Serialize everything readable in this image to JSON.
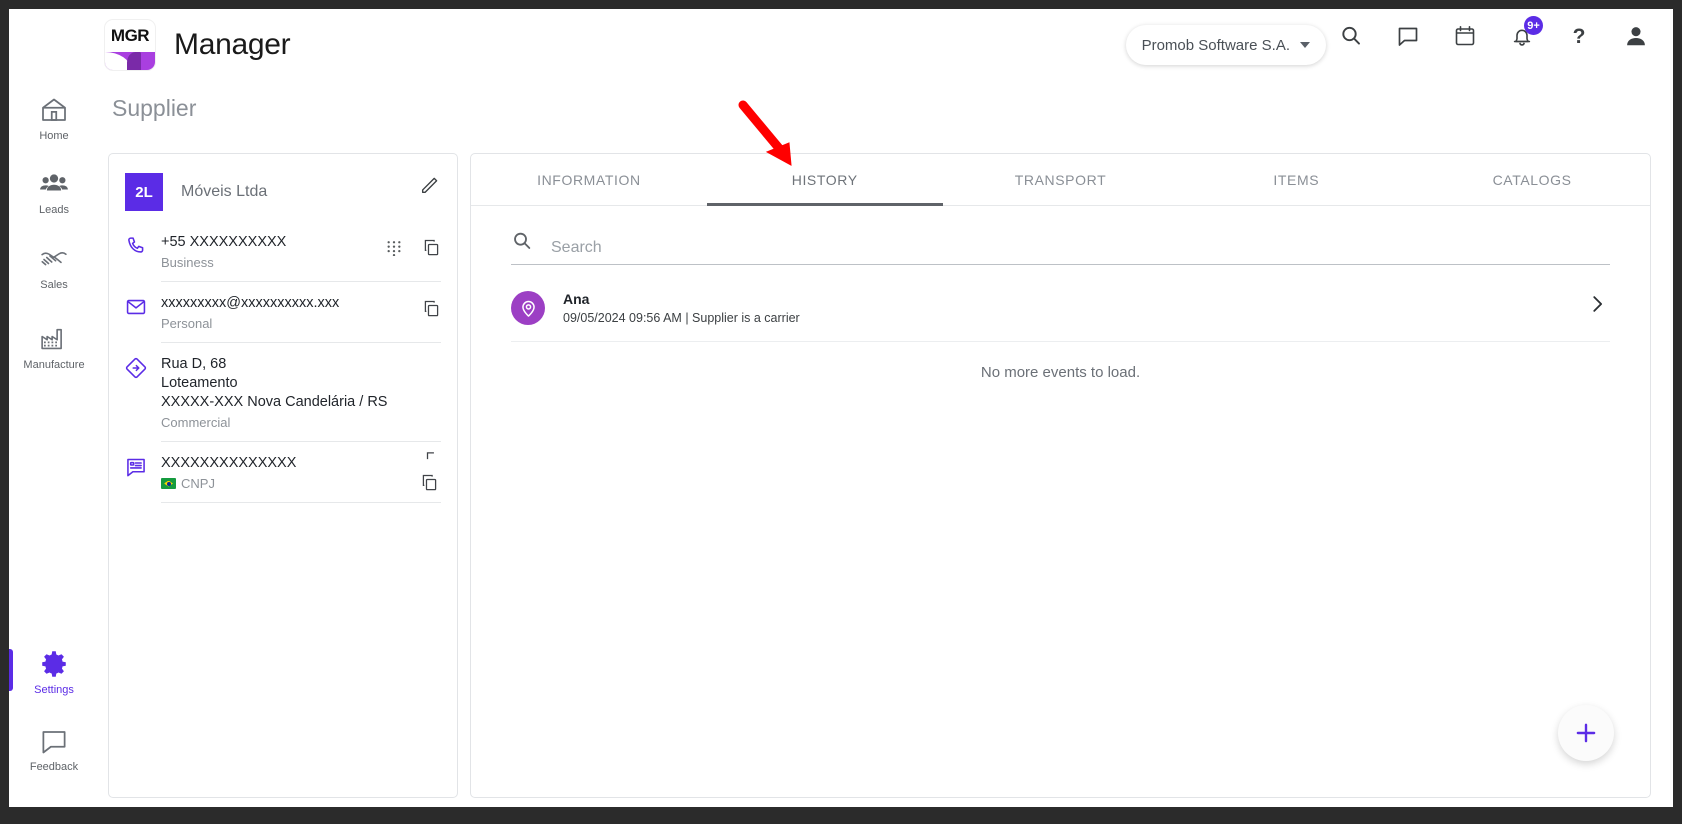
{
  "app": {
    "logo_text": "MGR",
    "title": "Manager"
  },
  "header": {
    "org_name": "Promob Software S.A.",
    "icons": [
      {
        "name": "search-icon"
      },
      {
        "name": "chat-icon"
      },
      {
        "name": "calendar-icon"
      },
      {
        "name": "notifications-bell-icon",
        "badge": "9+"
      },
      {
        "name": "help-question-icon"
      },
      {
        "name": "user-account-icon"
      }
    ]
  },
  "sidebar": {
    "items": [
      {
        "label": "Home",
        "icon": "home-icon",
        "active": false
      },
      {
        "label": "Leads",
        "icon": "leads-people-icon",
        "active": false
      },
      {
        "label": "Sales",
        "icon": "sales-handshake-icon",
        "active": false
      },
      {
        "label": "Manufacture",
        "icon": "factory-icon",
        "active": false
      },
      {
        "label": "Settings",
        "icon": "gear-icon",
        "active": true
      },
      {
        "label": "Feedback",
        "icon": "feedback-chat-icon",
        "active": false
      }
    ]
  },
  "page": {
    "title": "Supplier"
  },
  "supplier_card": {
    "avatar_initials": "2L",
    "company_name": "Móveis Ltda",
    "edit_icon": "pencil-edit-icon",
    "rows": [
      {
        "icon": "phone-icon",
        "value": "+55 XXXXXXXXXX",
        "label": "Business",
        "actions": [
          "dialpad-icon",
          "copy-icon"
        ]
      },
      {
        "icon": "email-envelope-icon",
        "value": "xxxxxxxxx@xxxxxxxxxx.xxx",
        "label": "Personal",
        "actions": [
          "copy-icon"
        ]
      },
      {
        "icon": "address-map-icon",
        "value_lines": [
          "Rua D, 68",
          "Loteamento",
          "XXXXX-XXX Nova Candelária / RS"
        ],
        "label": "Commercial",
        "actions": []
      },
      {
        "icon": "document-id-icon",
        "value": "XXXXXXXXXXXXXX",
        "label": "CNPJ",
        "flag": "brazil-flag-icon",
        "actions": [
          "copy-icon",
          "copy-icon"
        ]
      }
    ]
  },
  "main": {
    "tabs": [
      {
        "label": "INFORMATION",
        "active": false
      },
      {
        "label": "HISTORY",
        "active": true
      },
      {
        "label": "TRANSPORT",
        "active": false
      },
      {
        "label": "ITEMS",
        "active": false
      },
      {
        "label": "CATALOGS",
        "active": false
      }
    ],
    "search": {
      "placeholder": "Search",
      "value": "",
      "icon": "search-icon"
    },
    "events": [
      {
        "avatar_icon": "location-pin-icon",
        "name": "Ana",
        "meta": "09/05/2024 09:56 AM | Supplier is a carrier",
        "chevron": "chevron-right-icon"
      }
    ],
    "empty_state": "No more events to load.",
    "fab": {
      "icon": "plus-icon"
    }
  },
  "annotation": {
    "arrow_color": "#ff0000",
    "points_to": "HISTORY"
  },
  "colors": {
    "accent": "#5b2ce6",
    "avatar_purple": "#9c3fc4",
    "text_dark": "#1f2329",
    "text_muted": "#8d9298"
  }
}
